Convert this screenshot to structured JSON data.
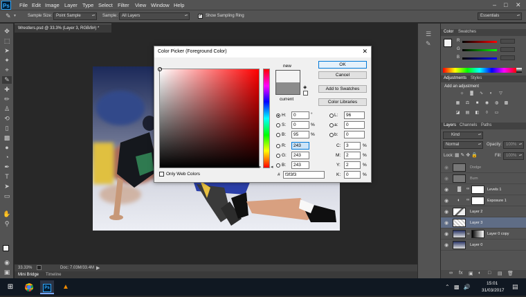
{
  "menubar": {
    "logo": "Ps",
    "items": [
      "File",
      "Edit",
      "Image",
      "Layer",
      "Type",
      "Select",
      "Filter",
      "View",
      "Window",
      "Help"
    ]
  },
  "options": {
    "sample_size_label": "Sample Size:",
    "sample_size_value": "Point Sample",
    "sample_label": "Sample:",
    "sample_value": "All Layers",
    "sampling_ring_label": "Show Sampling Ring",
    "workspace_value": "Essentials"
  },
  "document": {
    "tab_title": "Wrestlers.psd @ 33.3% (Layer 3, RGB/8#) *",
    "zoom": "33.33%",
    "doc_size": "Doc: 7.03M/33.4M"
  },
  "bottom_tabs": [
    "Mini Bridge",
    "Timeline"
  ],
  "color_panel": {
    "tabs": [
      "Color",
      "Swatches"
    ],
    "channels": [
      "R",
      "G",
      "B"
    ]
  },
  "adjustments_panel": {
    "tabs": [
      "Adjustments",
      "Styles"
    ],
    "heading": "Add an adjustment"
  },
  "layers_panel": {
    "tabs": [
      "Layers",
      "Channels",
      "Paths"
    ],
    "kind_label": "Kind",
    "blend_mode": "Normal",
    "opacity_label": "Opacity:",
    "opacity_value": "100%",
    "lock_label": "Lock:",
    "fill_label": "Fill:",
    "fill_value": "100%",
    "layers": [
      {
        "name": "Dodge"
      },
      {
        "name": "Burn"
      },
      {
        "name": "Levels 1"
      },
      {
        "name": "Exposure 1"
      },
      {
        "name": "Layer 2"
      },
      {
        "name": "Layer 3"
      },
      {
        "name": "Layer 0 copy"
      },
      {
        "name": "Layer 0"
      }
    ]
  },
  "color_picker": {
    "title": "Color Picker (Foreground Color)",
    "new_label": "new",
    "current_label": "current",
    "new_color": "#f3f3f3",
    "current_color": "#8c8c8c",
    "ok_label": "OK",
    "cancel_label": "Cancel",
    "add_swatches_label": "Add to Swatches",
    "libraries_label": "Color Libraries",
    "only_web_label": "Only Web Colors",
    "fields": {
      "H": {
        "label": "H:",
        "value": "0",
        "unit": "°"
      },
      "S": {
        "label": "S:",
        "value": "0",
        "unit": "%"
      },
      "Bv": {
        "label": "B:",
        "value": "95",
        "unit": "%"
      },
      "R": {
        "label": "R:",
        "value": "243"
      },
      "G": {
        "label": "G:",
        "value": "243"
      },
      "B": {
        "label": "B:",
        "value": "243"
      },
      "L": {
        "label": "L:",
        "value": "96"
      },
      "a": {
        "label": "a:",
        "value": "0"
      },
      "b": {
        "label": "b:",
        "value": "0"
      },
      "C": {
        "label": "C:",
        "value": "3",
        "unit": "%"
      },
      "M": {
        "label": "M:",
        "value": "2",
        "unit": "%"
      },
      "Y": {
        "label": "Y:",
        "value": "2",
        "unit": "%"
      },
      "K": {
        "label": "K:",
        "value": "0",
        "unit": "%"
      }
    },
    "hex_label": "#",
    "hex_value": "f3f3f3"
  },
  "taskbar": {
    "time": "15:01",
    "date": "31/03/2017"
  }
}
